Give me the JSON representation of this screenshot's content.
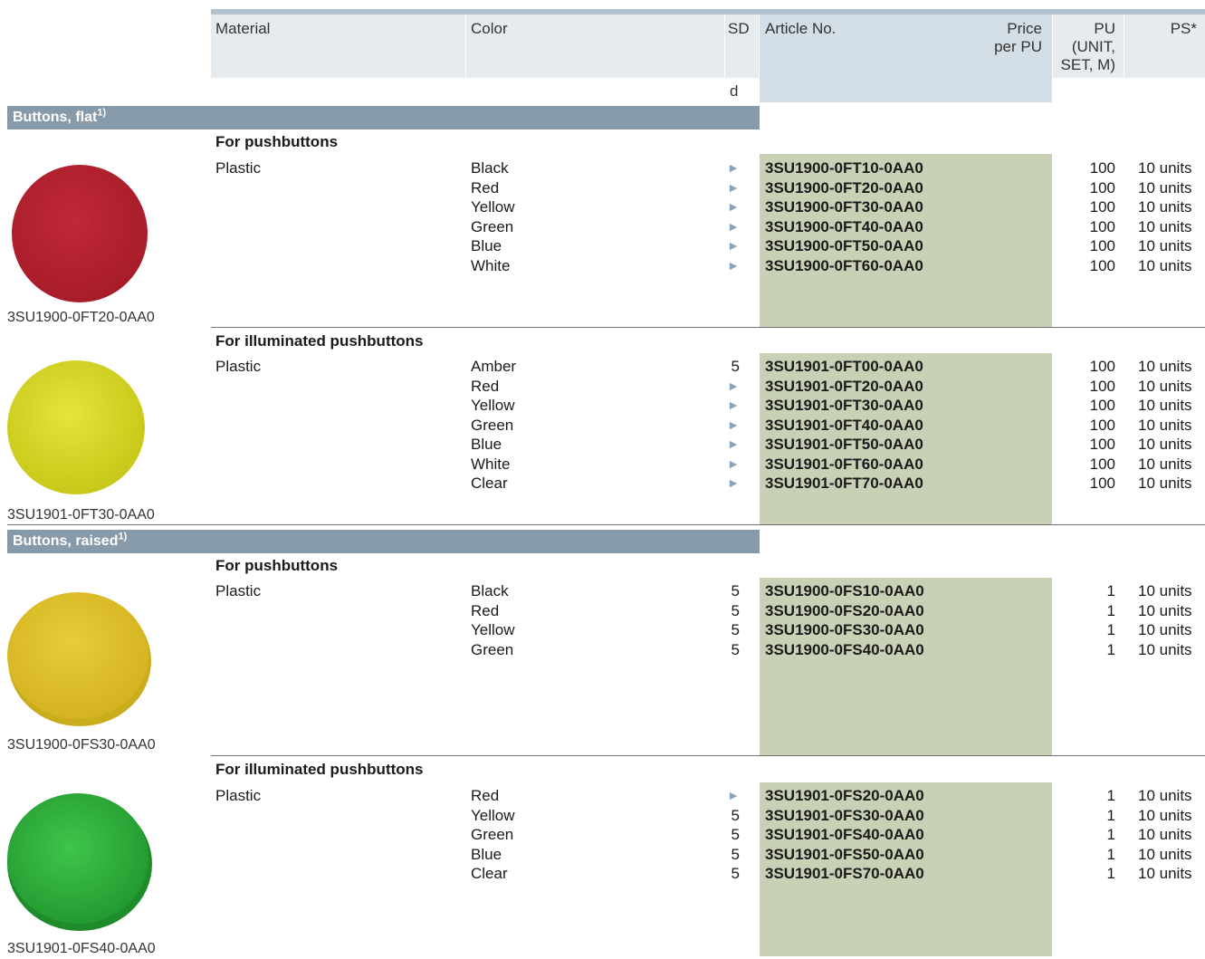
{
  "header": {
    "material": "Material",
    "color": "Color",
    "sd": "SD",
    "sd_unit": "d",
    "article_no": "Article No.",
    "price_line1": "Price",
    "price_line2": "per PU",
    "pu_line1": "PU",
    "pu_line2": "(UNIT,",
    "pu_line3": "SET, M)",
    "ps": "PS*"
  },
  "colors": {
    "band": "#879aaa",
    "article_bg": "#c8d1b5",
    "header_bg": "#e6ebef",
    "article_header_bg": "#d4dee6",
    "triangle": "#8aa3bb"
  },
  "sections": [
    {
      "title": "Buttons, flat",
      "footnote": "1)",
      "groups": [
        {
          "subtitle": "For pushbuttons",
          "material": "Plastic",
          "image_caption": "3SU1900-0FT20-0AA0",
          "image_color": "#b8232f",
          "rows": [
            {
              "color": "Black",
              "sd": "►",
              "article": "3SU1900-0FT10-0AA0",
              "pu": "100",
              "ps": "10 units"
            },
            {
              "color": "Red",
              "sd": "►",
              "article": "3SU1900-0FT20-0AA0",
              "pu": "100",
              "ps": "10 units"
            },
            {
              "color": "Yellow",
              "sd": "►",
              "article": "3SU1900-0FT30-0AA0",
              "pu": "100",
              "ps": "10 units"
            },
            {
              "color": "Green",
              "sd": "►",
              "article": "3SU1900-0FT40-0AA0",
              "pu": "100",
              "ps": "10 units"
            },
            {
              "color": "Blue",
              "sd": "►",
              "article": "3SU1900-0FT50-0AA0",
              "pu": "100",
              "ps": "10 units"
            },
            {
              "color": "White",
              "sd": "►",
              "article": "3SU1900-0FT60-0AA0",
              "pu": "100",
              "ps": "10 units"
            }
          ]
        },
        {
          "subtitle": "For illuminated pushbuttons",
          "material": "Plastic",
          "image_caption": "3SU1901-0FT30-0AA0",
          "image_color": "#d8d820",
          "rows": [
            {
              "color": "Amber",
              "sd": "5",
              "article": "3SU1901-0FT00-0AA0",
              "pu": "100",
              "ps": "10 units"
            },
            {
              "color": "Red",
              "sd": "►",
              "article": "3SU1901-0FT20-0AA0",
              "pu": "100",
              "ps": "10 units"
            },
            {
              "color": "Yellow",
              "sd": "►",
              "article": "3SU1901-0FT30-0AA0",
              "pu": "100",
              "ps": "10 units"
            },
            {
              "color": "Green",
              "sd": "►",
              "article": "3SU1901-0FT40-0AA0",
              "pu": "100",
              "ps": "10 units"
            },
            {
              "color": "Blue",
              "sd": "►",
              "article": "3SU1901-0FT50-0AA0",
              "pu": "100",
              "ps": "10 units"
            },
            {
              "color": "White",
              "sd": "►",
              "article": "3SU1901-0FT60-0AA0",
              "pu": "100",
              "ps": "10 units"
            },
            {
              "color": "Clear",
              "sd": "►",
              "article": "3SU1901-0FT70-0AA0",
              "pu": "100",
              "ps": "10 units"
            }
          ]
        }
      ]
    },
    {
      "title": "Buttons, raised",
      "footnote": "1)",
      "groups": [
        {
          "subtitle": "For pushbuttons",
          "material": "Plastic",
          "image_caption": "3SU1900-0FS30-0AA0",
          "image_color": "#e1c52c",
          "rows": [
            {
              "color": "Black",
              "sd": "5",
              "article": "3SU1900-0FS10-0AA0",
              "pu": "1",
              "ps": "10 units"
            },
            {
              "color": "Red",
              "sd": "5",
              "article": "3SU1900-0FS20-0AA0",
              "pu": "1",
              "ps": "10 units"
            },
            {
              "color": "Yellow",
              "sd": "5",
              "article": "3SU1900-0FS30-0AA0",
              "pu": "1",
              "ps": "10 units"
            },
            {
              "color": "Green",
              "sd": "5",
              "article": "3SU1900-0FS40-0AA0",
              "pu": "1",
              "ps": "10 units"
            }
          ]
        },
        {
          "subtitle": "For illuminated pushbuttons",
          "material": "Plastic",
          "image_caption": "3SU1901-0FS40-0AA0",
          "image_color": "#2fb03e",
          "rows": [
            {
              "color": "Red",
              "sd": "►",
              "article": "3SU1901-0FS20-0AA0",
              "pu": "1",
              "ps": "10 units"
            },
            {
              "color": "Yellow",
              "sd": "5",
              "article": "3SU1901-0FS30-0AA0",
              "pu": "1",
              "ps": "10 units"
            },
            {
              "color": "Green",
              "sd": "5",
              "article": "3SU1901-0FS40-0AA0",
              "pu": "1",
              "ps": "10 units"
            },
            {
              "color": "Blue",
              "sd": "5",
              "article": "3SU1901-0FS50-0AA0",
              "pu": "1",
              "ps": "10 units"
            },
            {
              "color": "Clear",
              "sd": "5",
              "article": "3SU1901-0FS70-0AA0",
              "pu": "1",
              "ps": "10 units"
            }
          ]
        }
      ]
    }
  ]
}
